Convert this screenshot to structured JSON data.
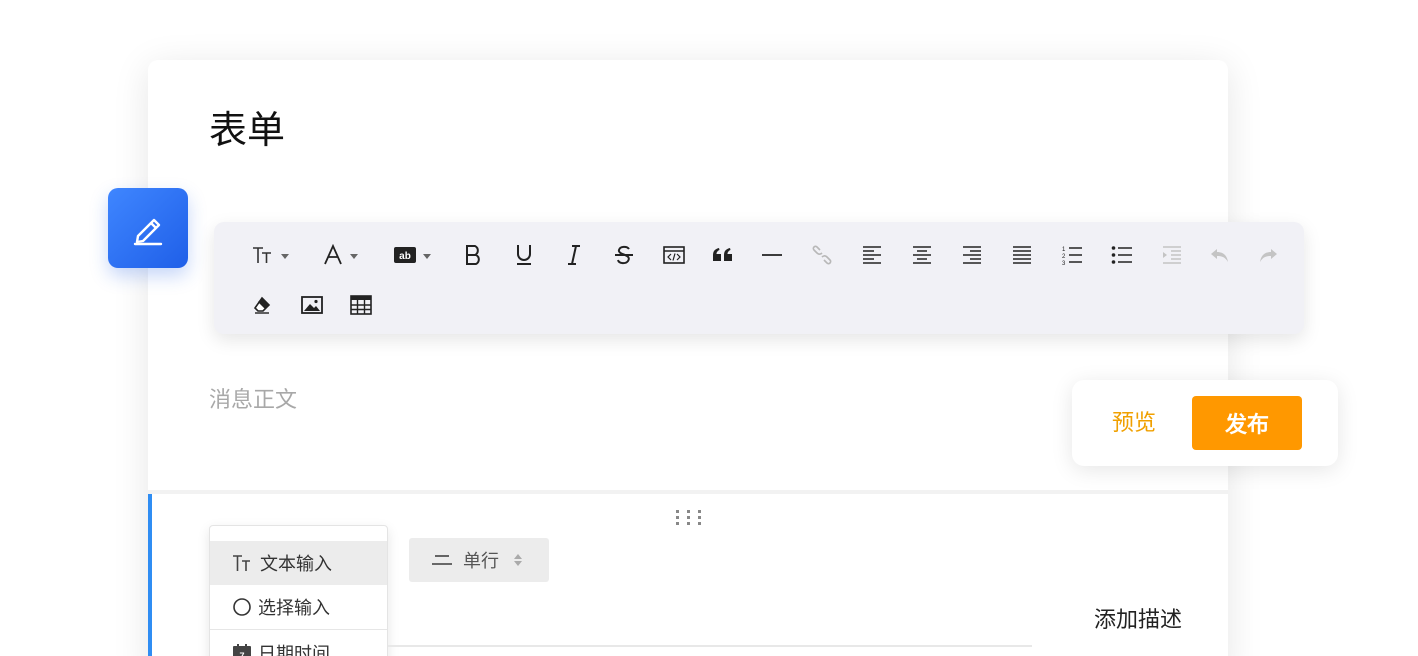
{
  "form": {
    "title": "表单",
    "body_placeholder": "消息正文"
  },
  "toolbar": {
    "row1": [
      {
        "name": "font-size",
        "glyph": "Tт",
        "dropdown": true
      },
      {
        "name": "font-color",
        "glyph": "A",
        "dropdown": true
      },
      {
        "name": "background-color",
        "glyph": "ab",
        "dropdown": true
      },
      {
        "name": "bold",
        "glyph": "B"
      },
      {
        "name": "underline",
        "glyph": "U"
      },
      {
        "name": "italic",
        "glyph": "I"
      },
      {
        "name": "strikethrough",
        "glyph": "S"
      },
      {
        "name": "code",
        "glyph": "</>"
      },
      {
        "name": "quote",
        "glyph": "❝"
      },
      {
        "name": "horizontal-rule",
        "glyph": "—"
      },
      {
        "name": "link",
        "glyph": "link"
      },
      {
        "name": "align-left",
        "glyph": "align-left"
      },
      {
        "name": "align-center",
        "glyph": "align-center"
      },
      {
        "name": "align-right",
        "glyph": "align-right"
      },
      {
        "name": "align-justify",
        "glyph": "justify"
      },
      {
        "name": "ordered-list",
        "glyph": "ol"
      },
      {
        "name": "unordered-list",
        "glyph": "ul"
      },
      {
        "name": "indent",
        "glyph": "indent",
        "disabled": true
      },
      {
        "name": "undo",
        "glyph": "undo",
        "disabled": true
      },
      {
        "name": "redo",
        "glyph": "redo",
        "disabled": true
      }
    ],
    "row2": [
      {
        "name": "clear-format",
        "glyph": "eraser"
      },
      {
        "name": "image",
        "glyph": "image"
      },
      {
        "name": "table",
        "glyph": "table"
      }
    ]
  },
  "actions": {
    "preview_label": "预览",
    "publish_label": "发布"
  },
  "field": {
    "type_options": [
      {
        "label": "文本输入",
        "icon": "text-icon",
        "selected": true
      },
      {
        "label": "选择输入",
        "icon": "radio-icon",
        "selected": false
      },
      {
        "label": "日期时间",
        "icon": "calendar-icon",
        "selected": false
      }
    ],
    "line_mode": "单行",
    "add_description": "添加描述"
  },
  "colors": {
    "accent_blue": "#2f8df3",
    "fab_blue": "#2b6ff3",
    "publish_orange": "#ff9800",
    "preview_orange": "#f0a000"
  }
}
